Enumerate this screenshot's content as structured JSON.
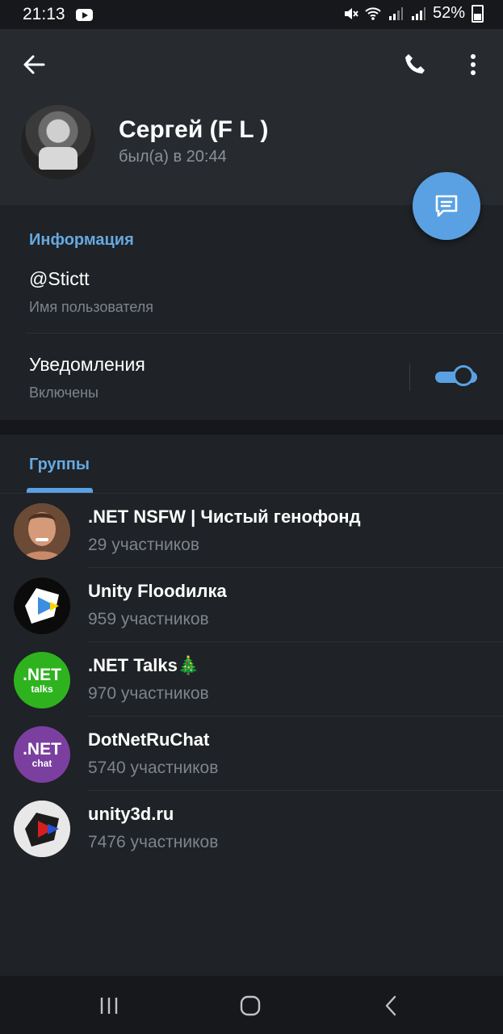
{
  "status": {
    "time": "21:13",
    "battery": "52%"
  },
  "profile": {
    "name": "Сергей (F L )",
    "last_seen": "был(а) в 20:44"
  },
  "info": {
    "section_title": "Информация",
    "username": "@Stictt",
    "username_label": "Имя пользователя",
    "notifications_label": "Уведомления",
    "notifications_status": "Включены",
    "notifications_enabled": true
  },
  "groups": {
    "tab_label": "Группы",
    "items": [
      {
        "name": ".NET NSFW | Чистый генофонд",
        "members": "29 участников"
      },
      {
        "name": "Unity Floodилка",
        "members": "959 участников"
      },
      {
        "name": ".NET Talks🎄",
        "members": "970 участников"
      },
      {
        "name": "DotNetRuChat",
        "members": "5740 участников"
      },
      {
        "name": "unity3d.ru",
        "members": "7476 участников"
      }
    ]
  },
  "logos": {
    "net_talks": {
      "big": ".NET",
      "small": "talks"
    },
    "dotnetru": {
      "big": ".NET",
      "small": "chat"
    }
  },
  "colors": {
    "accent": "#5aa1e3",
    "section_title": "#66a9e0",
    "header_bg": "#272b30",
    "body_bg": "#1f2226"
  }
}
